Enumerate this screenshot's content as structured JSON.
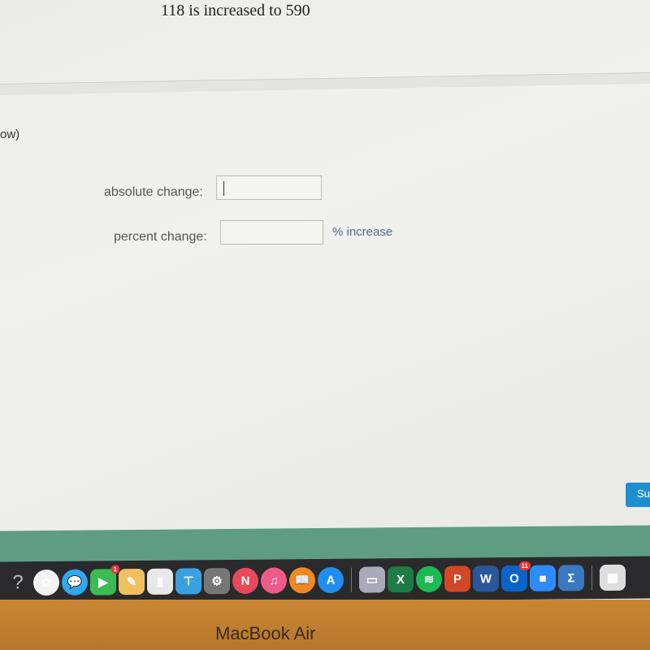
{
  "question": {
    "title": "118 is increased to 590",
    "fragment": "ow)"
  },
  "form": {
    "absolute_label": "absolute change:",
    "absolute_value": "",
    "percent_label": "percent change:",
    "percent_value": "",
    "percent_suffix": "% increase"
  },
  "submit_label": "Su",
  "dock": {
    "apps": [
      {
        "name": "help",
        "glyph": "?",
        "color": "#2a2a2c"
      },
      {
        "name": "photos",
        "glyph": "✿",
        "color": "#f2f2f2"
      },
      {
        "name": "messages",
        "glyph": "💬",
        "color": "#2fa8f0"
      },
      {
        "name": "facetime",
        "glyph": "▶",
        "color": "#3cba54",
        "badge": "1"
      },
      {
        "name": "pages",
        "glyph": "✎",
        "color": "#f0c060"
      },
      {
        "name": "numbers",
        "glyph": "▮",
        "color": "#e8e8e8"
      },
      {
        "name": "keynote",
        "glyph": "⊤",
        "color": "#3aa0e0"
      },
      {
        "name": "system-preferences",
        "glyph": "⚙",
        "color": "#777"
      },
      {
        "name": "news",
        "glyph": "N",
        "color": "#e8485a"
      },
      {
        "name": "music",
        "glyph": "♫",
        "color": "#f05a8a"
      },
      {
        "name": "books",
        "glyph": "📖",
        "color": "#f08a20"
      },
      {
        "name": "app-store",
        "glyph": "A",
        "color": "#1f8ef0"
      },
      {
        "name": "preview",
        "glyph": "▭",
        "color": "#aab"
      },
      {
        "name": "excel",
        "glyph": "X",
        "color": "#1e7b45"
      },
      {
        "name": "spotify",
        "glyph": "≋",
        "color": "#1db954"
      },
      {
        "name": "powerpoint",
        "glyph": "P",
        "color": "#d24726"
      },
      {
        "name": "word",
        "glyph": "W",
        "color": "#2b579a"
      },
      {
        "name": "outlook",
        "glyph": "O",
        "color": "#0a64c8",
        "badge": "11"
      },
      {
        "name": "zoom",
        "glyph": "■",
        "color": "#2d8cff"
      },
      {
        "name": "sigma",
        "glyph": "Σ",
        "color": "#3a78c0"
      },
      {
        "name": "calendar",
        "glyph": "▦",
        "color": "#ddd"
      }
    ]
  },
  "device_label": "MacBook Air"
}
